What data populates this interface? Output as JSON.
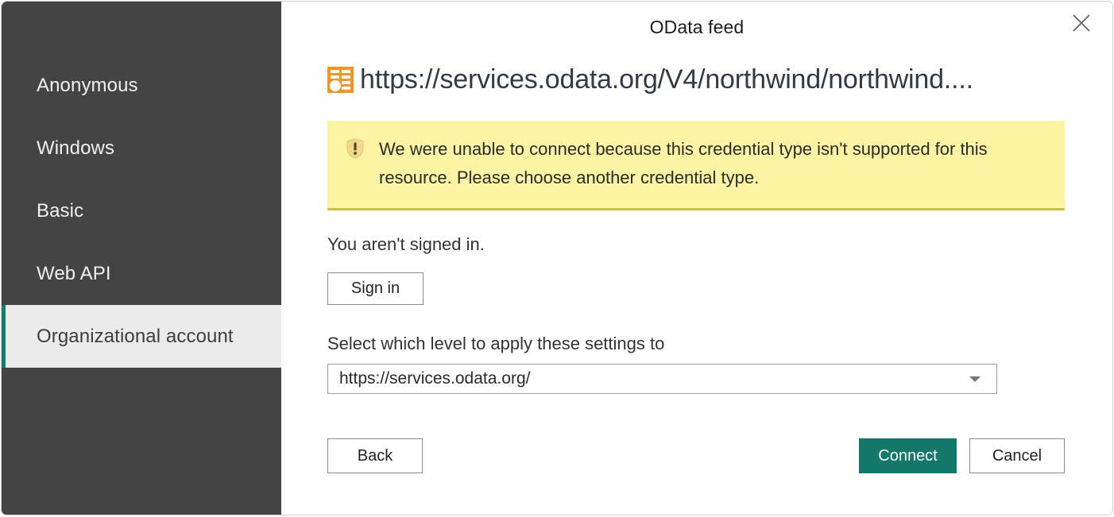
{
  "dialog": {
    "title": "OData feed",
    "close_icon": "close-icon"
  },
  "source": {
    "icon": "odata-table-icon",
    "url": "https://services.odata.org/V4/northwind/northwind...."
  },
  "sidebar": {
    "items": [
      {
        "label": "Anonymous",
        "selected": false
      },
      {
        "label": "Windows",
        "selected": false
      },
      {
        "label": "Basic",
        "selected": false
      },
      {
        "label": "Web API",
        "selected": false
      },
      {
        "label": "Organizational account",
        "selected": true
      }
    ],
    "selected_accent_color": "#127f71",
    "background_color": "#444444",
    "selected_background_color": "#ebebeb"
  },
  "warning": {
    "icon": "warning-shield-icon",
    "message": "We were unable to connect because this credential type isn't supported for this resource. Please choose another credential type.",
    "background_color": "#fcf4a3",
    "border_color": "#ccc23d"
  },
  "auth": {
    "status_text": "You aren't signed in.",
    "sign_in_label": "Sign in"
  },
  "level": {
    "label": "Select which level to apply these settings to",
    "selected_value": "https://services.odata.org/",
    "dropdown_icon": "chevron-down-icon"
  },
  "footer": {
    "back_label": "Back",
    "connect_label": "Connect",
    "cancel_label": "Cancel",
    "connect_color": "#11786a"
  }
}
